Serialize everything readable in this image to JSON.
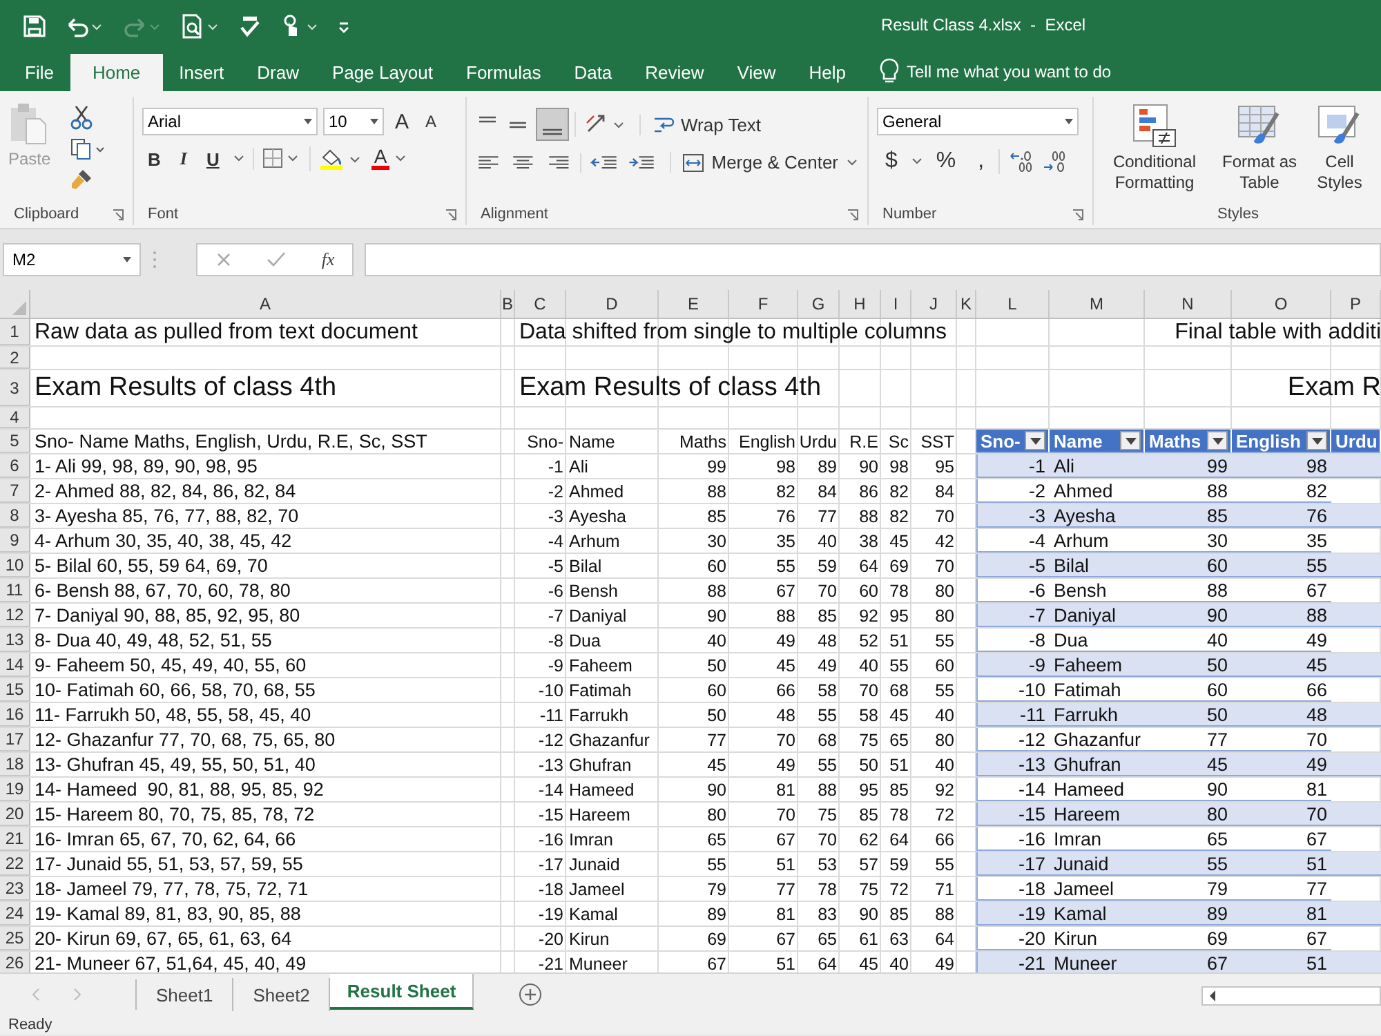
{
  "window": {
    "title": "Result Class 4.xlsx  -  Excel"
  },
  "menu_tabs": [
    {
      "label": "File",
      "selected": false
    },
    {
      "label": "Home",
      "selected": true
    },
    {
      "label": "Insert",
      "selected": false
    },
    {
      "label": "Draw",
      "selected": false
    },
    {
      "label": "Page Layout",
      "selected": false
    },
    {
      "label": "Formulas",
      "selected": false
    },
    {
      "label": "Data",
      "selected": false
    },
    {
      "label": "Review",
      "selected": false
    },
    {
      "label": "View",
      "selected": false
    },
    {
      "label": "Help",
      "selected": false
    }
  ],
  "tell_me": "Tell me what you want to do",
  "ribbon": {
    "clipboard": {
      "paste": "Paste",
      "label": "Clipboard"
    },
    "font": {
      "family": "Arial",
      "size": "10",
      "grow": "A",
      "shrink": "A",
      "bold": "B",
      "italic": "I",
      "underline": "U",
      "color_letter": "A",
      "label": "Font"
    },
    "alignment": {
      "wrap": "Wrap Text",
      "merge": "Merge & Center",
      "label": "Alignment"
    },
    "number": {
      "format": "General",
      "currency": "$",
      "percent": "%",
      "comma": ",",
      "label": "Number"
    },
    "styles": {
      "buttons": [
        {
          "label": "Conditional Formatting",
          "kind": "conditional"
        },
        {
          "label": "Format as Table",
          "kind": "table"
        },
        {
          "label": "Cell Styles",
          "kind": "cell"
        }
      ],
      "label": "Styles"
    }
  },
  "formula_bar": {
    "name_box": "M2",
    "function_label": "fx"
  },
  "sheet": {
    "column_headers": [
      "A",
      "B",
      "C",
      "D",
      "E",
      "F",
      "G",
      "H",
      "I",
      "J",
      "K",
      "L",
      "M",
      "N",
      "O",
      "P"
    ],
    "row_headers": [
      "1",
      "2",
      "3",
      "4",
      "5",
      "6",
      "7",
      "8",
      "9",
      "10",
      "11",
      "12",
      "13",
      "14",
      "15",
      "16",
      "17",
      "18",
      "19",
      "20",
      "21",
      "22",
      "23",
      "24",
      "25",
      "26"
    ]
  },
  "raw_block": {
    "title": "Raw data as pulled from text document",
    "heading": "Exam Results of class 4th",
    "header_line": "Sno- Name Maths, English, Urdu, R.E, Sc, SST",
    "lines": [
      "1- Ali 99, 98, 89, 90, 98, 95",
      "2- Ahmed 88, 82, 84, 86, 82, 84",
      "3- Ayesha 85, 76, 77, 88, 82, 70",
      "4- Arhum 30, 35, 40, 38, 45, 42",
      "5- Bilal 60, 55, 59 64, 69, 70",
      "6- Bensh 88, 67, 70, 60, 78, 80",
      "7- Daniyal 90, 88, 85, 92, 95, 80",
      "8- Dua 40, 49, 48, 52, 51, 55",
      "9- Faheem 50, 45, 49, 40, 55, 60",
      "10- Fatimah 60, 66, 58, 70, 68, 55",
      "11- Farrukh 50, 48, 55, 58, 45, 40",
      "12- Ghazanfur 77, 70, 68, 75, 65, 80",
      "13- Ghufran 45, 49, 55, 50, 51, 40",
      "14- Hameed  90, 81, 88, 95, 85, 92",
      "15- Hareem 80, 70, 75, 85, 78, 72",
      "16- Imran 65, 67, 70, 62, 64, 66",
      "17- Junaid 55, 51, 53, 57, 59, 55",
      "18- Jameel 79, 77, 78, 75, 72, 71",
      "19- Kamal 89, 81, 83, 90, 85, 88",
      "20- Kirun 69, 67, 65, 61, 63, 64",
      "21- Muneer 67, 51,64, 45, 40, 49"
    ]
  },
  "split_block": {
    "title": "Data shifted from single to multiple columns",
    "heading": "Exam Results of class 4th",
    "columns": [
      "Sno-",
      "Name",
      "Maths",
      "English",
      "Urdu",
      "R.E",
      "Sc",
      "SST"
    ],
    "rows": [
      {
        "sno": "-1",
        "name": "Ali",
        "scores": [
          "99",
          "98",
          "89",
          "90",
          "98",
          "95"
        ]
      },
      {
        "sno": "-2",
        "name": "Ahmed",
        "scores": [
          "88",
          "82",
          "84",
          "86",
          "82",
          "84"
        ]
      },
      {
        "sno": "-3",
        "name": "Ayesha",
        "scores": [
          "85",
          "76",
          "77",
          "88",
          "82",
          "70"
        ]
      },
      {
        "sno": "-4",
        "name": "Arhum",
        "scores": [
          "30",
          "35",
          "40",
          "38",
          "45",
          "42"
        ]
      },
      {
        "sno": "-5",
        "name": "Bilal",
        "scores": [
          "60",
          "55",
          "59",
          "64",
          "69",
          "70"
        ]
      },
      {
        "sno": "-6",
        "name": "Bensh",
        "scores": [
          "88",
          "67",
          "70",
          "60",
          "78",
          "80"
        ]
      },
      {
        "sno": "-7",
        "name": "Daniyal",
        "scores": [
          "90",
          "88",
          "85",
          "92",
          "95",
          "80"
        ]
      },
      {
        "sno": "-8",
        "name": "Dua",
        "scores": [
          "40",
          "49",
          "48",
          "52",
          "51",
          "55"
        ]
      },
      {
        "sno": "-9",
        "name": "Faheem",
        "scores": [
          "50",
          "45",
          "49",
          "40",
          "55",
          "60"
        ]
      },
      {
        "sno": "-10",
        "name": "Fatimah",
        "scores": [
          "60",
          "66",
          "58",
          "70",
          "68",
          "55"
        ]
      },
      {
        "sno": "-11",
        "name": "Farrukh",
        "scores": [
          "50",
          "48",
          "55",
          "58",
          "45",
          "40"
        ]
      },
      {
        "sno": "-12",
        "name": "Ghazanfur",
        "scores": [
          "77",
          "70",
          "68",
          "75",
          "65",
          "80"
        ]
      },
      {
        "sno": "-13",
        "name": "Ghufran",
        "scores": [
          "45",
          "49",
          "55",
          "50",
          "51",
          "40"
        ]
      },
      {
        "sno": "-14",
        "name": "Hameed",
        "scores": [
          "90",
          "81",
          "88",
          "95",
          "85",
          "92"
        ]
      },
      {
        "sno": "-15",
        "name": "Hareem",
        "scores": [
          "80",
          "70",
          "75",
          "85",
          "78",
          "72"
        ]
      },
      {
        "sno": "-16",
        "name": "Imran",
        "scores": [
          "65",
          "67",
          "70",
          "62",
          "64",
          "66"
        ]
      },
      {
        "sno": "-17",
        "name": "Junaid",
        "scores": [
          "55",
          "51",
          "53",
          "57",
          "59",
          "55"
        ]
      },
      {
        "sno": "-18",
        "name": "Jameel",
        "scores": [
          "79",
          "77",
          "78",
          "75",
          "72",
          "71"
        ]
      },
      {
        "sno": "-19",
        "name": "Kamal",
        "scores": [
          "89",
          "81",
          "83",
          "90",
          "85",
          "88"
        ]
      },
      {
        "sno": "-20",
        "name": "Kirun",
        "scores": [
          "69",
          "67",
          "65",
          "61",
          "63",
          "64"
        ]
      },
      {
        "sno": "-21",
        "name": "Muneer",
        "scores": [
          "67",
          "51",
          "64",
          "45",
          "40",
          "49"
        ]
      }
    ]
  },
  "table_block": {
    "title": "Final table with additi",
    "heading": "Exam R",
    "columns": [
      {
        "label": "Sno-",
        "filter": true
      },
      {
        "label": "Name",
        "filter": true
      },
      {
        "label": "Maths",
        "filter": true
      },
      {
        "label": "English",
        "filter": true
      },
      {
        "label": "Urdu",
        "filter": false
      }
    ],
    "rows": [
      {
        "sno": "-1",
        "name": "Ali",
        "maths": "99",
        "english": "98"
      },
      {
        "sno": "-2",
        "name": "Ahmed",
        "maths": "88",
        "english": "82"
      },
      {
        "sno": "-3",
        "name": "Ayesha",
        "maths": "85",
        "english": "76"
      },
      {
        "sno": "-4",
        "name": "Arhum",
        "maths": "30",
        "english": "35"
      },
      {
        "sno": "-5",
        "name": "Bilal",
        "maths": "60",
        "english": "55"
      },
      {
        "sno": "-6",
        "name": "Bensh",
        "maths": "88",
        "english": "67"
      },
      {
        "sno": "-7",
        "name": "Daniyal",
        "maths": "90",
        "english": "88"
      },
      {
        "sno": "-8",
        "name": "Dua",
        "maths": "40",
        "english": "49"
      },
      {
        "sno": "-9",
        "name": "Faheem",
        "maths": "50",
        "english": "45"
      },
      {
        "sno": "-10",
        "name": "Fatimah",
        "maths": "60",
        "english": "66"
      },
      {
        "sno": "-11",
        "name": "Farrukh",
        "maths": "50",
        "english": "48"
      },
      {
        "sno": "-12",
        "name": "Ghazanfur",
        "maths": "77",
        "english": "70"
      },
      {
        "sno": "-13",
        "name": "Ghufran",
        "maths": "45",
        "english": "49"
      },
      {
        "sno": "-14",
        "name": "Hameed",
        "maths": "90",
        "english": "81"
      },
      {
        "sno": "-15",
        "name": "Hareem",
        "maths": "80",
        "english": "70"
      },
      {
        "sno": "-16",
        "name": "Imran",
        "maths": "65",
        "english": "67"
      },
      {
        "sno": "-17",
        "name": "Junaid",
        "maths": "55",
        "english": "51"
      },
      {
        "sno": "-18",
        "name": "Jameel",
        "maths": "79",
        "english": "77"
      },
      {
        "sno": "-19",
        "name": "Kamal",
        "maths": "89",
        "english": "81"
      },
      {
        "sno": "-20",
        "name": "Kirun",
        "maths": "69",
        "english": "67"
      },
      {
        "sno": "-21",
        "name": "Muneer",
        "maths": "67",
        "english": "51"
      }
    ]
  },
  "sheet_tabs": [
    {
      "label": "Sheet1",
      "selected": false
    },
    {
      "label": "Sheet2",
      "selected": false
    },
    {
      "label": "Result Sheet",
      "selected": true
    }
  ],
  "status_bar": {
    "text": "Ready"
  }
}
